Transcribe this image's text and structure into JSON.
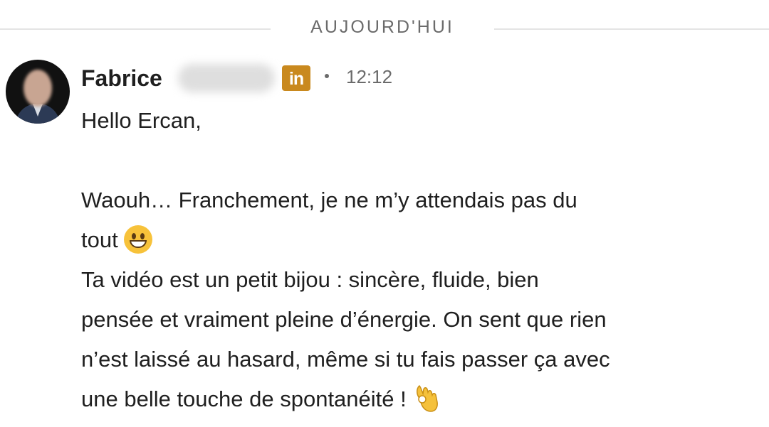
{
  "divider": {
    "label": "AUJOURD'HUI"
  },
  "message": {
    "sender_first_name": "Fabrice",
    "linkedin_badge": "in",
    "time": "12:12",
    "greeting": "Hello Ercan,",
    "body_lines": [
      "Waouh… Franchement, je ne m’y attendais pas du",
      "tout",
      "Ta vidéo est un petit bijou : sincère, fluide, bien",
      "pensée et vraiment pleine d’énergie. On sent que rien",
      "n’est laissé au hasard, même si tu fais passer ça avec",
      "une belle touche de spontanéité !"
    ]
  },
  "icons": {
    "linkedin": "linkedin-icon",
    "grin_emoji": "grinning-face-emoji",
    "ok_emoji": "ok-hand-emoji"
  },
  "colors": {
    "linkedin_badge_bg": "#c9891e",
    "divider_line": "#e4e4e4",
    "muted_text": "#6b6b6b",
    "body_text": "#1f1f1f"
  }
}
